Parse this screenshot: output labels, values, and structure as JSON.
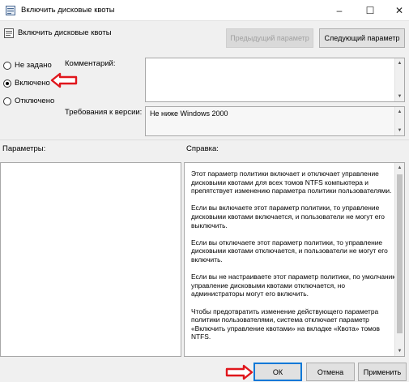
{
  "window": {
    "title": "Включить дисковые квоты",
    "controls": [
      "–",
      "☐",
      "✕"
    ]
  },
  "header": {
    "policy_name": "Включить дисковые квоты",
    "prev_button": "Предыдущий параметр",
    "next_button": "Следующий параметр"
  },
  "state": {
    "options": [
      {
        "label": "Не задано",
        "checked": false
      },
      {
        "label": "Включено",
        "checked": true
      },
      {
        "label": "Отключено",
        "checked": false
      }
    ]
  },
  "comment": {
    "label": "Комментарий:",
    "value": ""
  },
  "requirements": {
    "label": "Требования к версии:",
    "value": "Не ниже Windows 2000"
  },
  "params": {
    "label": "Параметры:"
  },
  "help": {
    "label": "Справка:",
    "paragraphs": [
      "Этот параметр политики включает и отключает управление дисковыми квотами для всех томов NTFS компьютера и препятствует изменению параметра политики пользователями.",
      "Если вы включаете этот параметр политики, то управление дисковыми квотами включается, и пользователи не могут его выключить.",
      "Если вы отключаете этот параметр политики, то управление дисковыми квотами отключается, и пользователи не могут его включить.",
      "Если вы не настраиваете этот параметр политики, по умолчанию управление дисковыми квотами отключается, но администраторы могут его включить.",
      "Чтобы предотвратить изменение действующего параметра политики пользователями, система отключает параметр «Включить управление квотами» на вкладке «Квота» томов NTFS."
    ]
  },
  "footer": {
    "ok": "ОК",
    "cancel": "Отмена",
    "apply": "Применить"
  },
  "colors": {
    "accent": "#0078d7",
    "annotation_arrow": "#e0161c"
  }
}
